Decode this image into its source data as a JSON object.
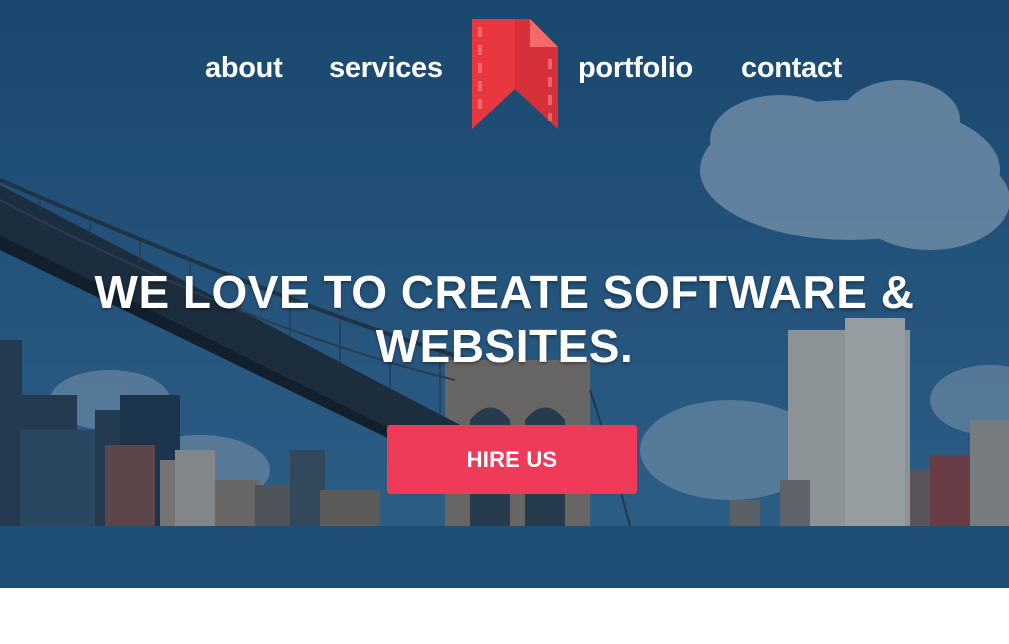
{
  "nav": {
    "items": [
      {
        "label": "about"
      },
      {
        "label": "services"
      },
      {
        "label": "portfolio"
      },
      {
        "label": "contact"
      }
    ]
  },
  "logo": {
    "icon": "bookmark-ribbon-logo",
    "colors": [
      "#e8373f",
      "#d6303a",
      "#f26a6a"
    ]
  },
  "hero": {
    "headline_line1": "WE LOVE TO CREATE SOFTWARE &",
    "headline_line2": "WEBSITES.",
    "cta_label": "HIRE US",
    "cta_color": "#f03a5a"
  }
}
